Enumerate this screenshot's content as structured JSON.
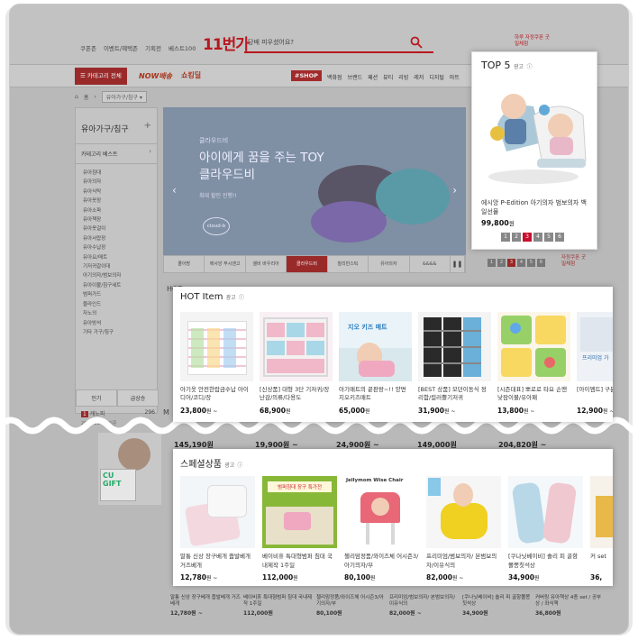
{
  "header": {
    "toplinks": [
      "쿠폰존",
      "이벤트/혜택존",
      "기획전",
      "베스트100"
    ],
    "logo": "11번가",
    "search_placeholder": "당배 피우셨어요?",
    "right_promo": "하루 자정쿠폰 굿밀체험"
  },
  "nav": {
    "category_all": "카테고리 전체",
    "now": "NOW배송",
    "shocking": "쇼킹딜",
    "shop": "#SHOP",
    "categories": [
      "백화점",
      "브랜드",
      "패션",
      "뷰티",
      "리빙",
      "레저",
      "디지털",
      "마트"
    ]
  },
  "breadcrumb": {
    "home": "홈",
    "current": "유아가구/침구"
  },
  "sidebar": {
    "title": "유아가구/침구",
    "best": "카테고리 베스트",
    "items": [
      "유아침대",
      "유아의자",
      "유아식탁",
      "유아옷장",
      "유아소파",
      "유아책장",
      "유아옷걸이",
      "유아서랍장",
      "유아수납장",
      "유아요/매트",
      "기저귀갈이대",
      "아기의자/범보의자",
      "유아이불/침구세트",
      "범퍼가드",
      "블라인드",
      "자노의",
      "유아방석",
      "기타 가구/침구"
    ],
    "tabs": [
      "인기",
      "급상승"
    ],
    "rank_label": "캐노피",
    "rank_value": "296",
    "date": "2017.11.13 기준"
  },
  "banner": {
    "brand": "클라우드비",
    "headline_line1": "아이에게 꿈을 주는 TOY",
    "headline_line2": "클라우드비",
    "sub": "최대 할인 진행!!",
    "logo": "cloud-b",
    "tabs": [
      "쿨아방",
      "에사앙 푸시앤고",
      "셀비 바우리아",
      "클라우드비",
      "칠리빈스틱",
      "유아의자",
      "&&&&"
    ],
    "active_tab": 3
  },
  "top5": {
    "title": "TOP 5",
    "ad": "광고",
    "product_name": "에시앙 P-Edition 아기의자 범보의자 백일선물",
    "price": "99,800",
    "won": "원",
    "pages": [
      "1",
      "2",
      "3",
      "4",
      "5",
      "6"
    ],
    "current_page": 2
  },
  "hot": {
    "title": "HOT Item",
    "ad": "광고",
    "items": [
      {
        "name": "아기옷 안전한랍금수납 아이디어/코디/장",
        "price": "23,800",
        "suffix": "원 ~"
      },
      {
        "name": "[신상품] 대형 3단 기저귀/장난감/의류/다용도",
        "price": "68,900",
        "suffix": "원"
      },
      {
        "name": "아기매트의 끝판왕~!! 양면 지오키즈매트",
        "price": "65,000",
        "suffix": "원"
      },
      {
        "name": "[BEST 상품] 모던이동식 정리함/컬러쁠기저귀",
        "price": "31,900",
        "suffix": "원 ~"
      },
      {
        "name": "[시즌대표] 뽀로로 타요 손맨 낮잠이불/유아패",
        "price": "13,800",
        "suffix": "원 ~"
      },
      {
        "name": "[아이엠트] 구분/수납",
        "price": "12,900",
        "suffix": "원 ~"
      }
    ],
    "thumb_texts": [
      "",
      "",
      "지오 키즈 매트",
      "",
      "",
      "프리미엄 가"
    ]
  },
  "background": {
    "hot_label": "HOT",
    "m_label": "M",
    "prices": [
      "145,190원",
      "19,900원 ~",
      "24,900원 ~",
      "149,000원",
      "204,820원 ~"
    ],
    "ad_card_text": "CU GIFT",
    "bottom_items": [
      {
        "name": "말통 신상 장구베개 줍발베개 거즈베개",
        "price": "12,780원 ~"
      },
      {
        "name": "베이비휴 특대형범퍼 침대 국내제작 1주일",
        "price": "112,000원"
      },
      {
        "name": "첼리맘정품/와이즈체 어시즌3/아기의자/부",
        "price": "80,100원"
      },
      {
        "name": "프리미엄/범보의자/ 본범보의자/이유식의",
        "price": "82,000원 ~"
      },
      {
        "name": "[쿠나닛베이비] 솔리 피 골항쫄쫑칫석상",
        "price": "34,900원"
      },
      {
        "name": "커버링 유아책상 4종 set / 공부상 / 좌식책",
        "price": "36,800원"
      }
    ],
    "side_right": "자정쿠폰 굿밀체험"
  },
  "special": {
    "title": "스페셜상품",
    "ad": "광고",
    "items": [
      {
        "name": "말통 신상 장구베개 줍발베개 거즈베개",
        "price": "12,780",
        "suffix": "원 ~"
      },
      {
        "name": "베이비휴 특대형범퍼 침대 국내제작 1주일",
        "price": "112,000",
        "suffix": "원"
      },
      {
        "name": "첼리맘정품/와이즈체 어시즌3/아기의자/부",
        "price": "80,100",
        "suffix": "원"
      },
      {
        "name": "프리미엄/범보의자/ 본범보의자/이유식의",
        "price": "82,000",
        "suffix": "원 ~"
      },
      {
        "name": "[쿠나닛베이비] 솔리 피 골항쫄쫑칫석상",
        "price": "34,900",
        "suffix": "원"
      },
      {
        "name": "커 set",
        "price": "36,",
        "suffix": ""
      }
    ],
    "thumb_texts": [
      "",
      "범퍼침대 장구 특가전",
      "Jellymom Wise Chair",
      "",
      "",
      ""
    ]
  }
}
